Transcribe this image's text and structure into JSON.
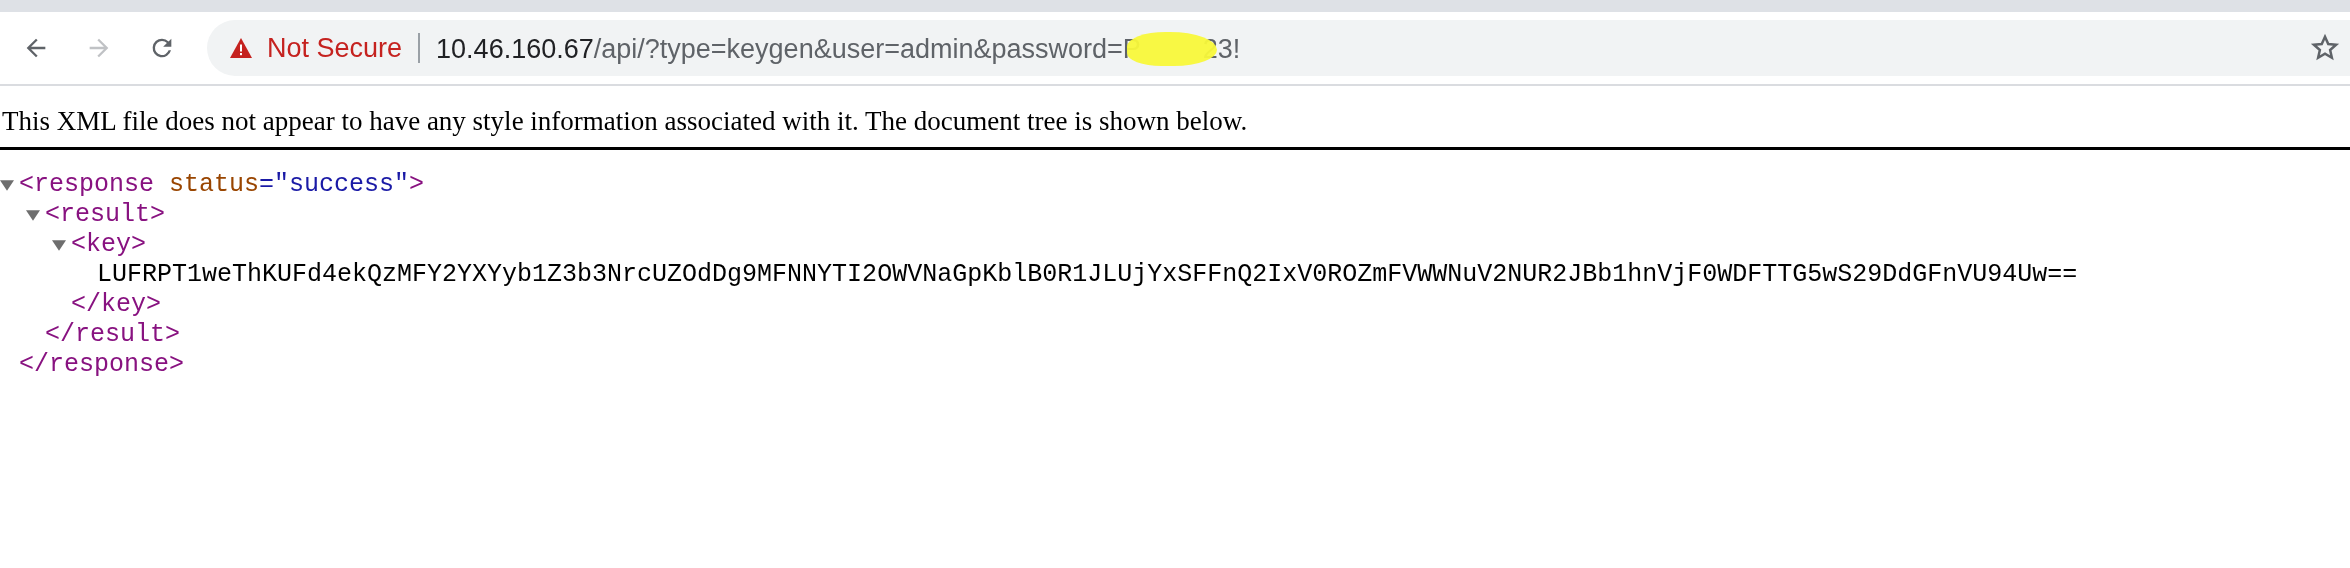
{
  "toolbar": {
    "nav": [
      {
        "kind": "back",
        "disabled": false
      },
      {
        "kind": "forward",
        "disabled": true
      },
      {
        "kind": "reload",
        "disabled": false
      }
    ],
    "omnibox": {
      "security": "Not Secure",
      "url_parts": [
        {
          "kind": "host",
          "text": "10.46.160.67"
        },
        {
          "kind": "path",
          "text": "/api/?type=keygen&user=admin&password=P"
        },
        {
          "kind": "redaction"
        },
        {
          "kind": "path",
          "text": "23!"
        }
      ],
      "bookmarked": false
    }
  },
  "notice": "This XML file does not appear to have any style information associated with it. The document tree is shown below.",
  "tree": {
    "open": "<response",
    "attributes": [
      {
        "name": "status",
        "value": "=\"success\""
      }
    ],
    "open_end": ">",
    "close": "</response>",
    "expanded": true,
    "children": [
      {
        "open": "<result",
        "open_end": ">",
        "close": "</result>",
        "expanded": true,
        "children": [
          {
            "open": "<key",
            "open_end": ">",
            "close": "</key>",
            "expanded": true,
            "children": [
              {
                "text": "LUFRPT1weThKUFd4ekQzMFY2YXYyb1Z3b3NrcUZOdDg9MFNNYTI2OWVNaGpKblB0R1JLUjYxSFFnQ2IxV0ROZmFVWWNuV2NUR2JBb1hnVjF0WDFTTG5wS29DdGFnVU94Uw=="
              }
            ]
          }
        ]
      }
    ]
  }
}
